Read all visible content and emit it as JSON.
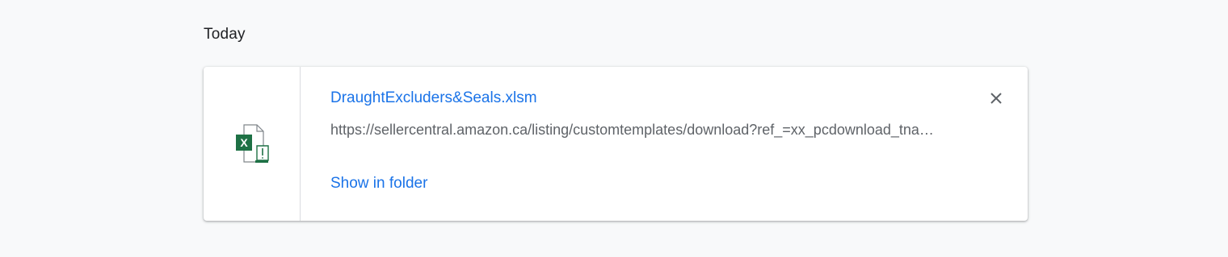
{
  "section": {
    "title": "Today"
  },
  "download": {
    "file_name": "DraughtExcluders&Seals.xlsm",
    "url": "https://sellercentral.amazon.ca/listing/customtemplates/download?ref_=xx_pcdownload_tnav_add",
    "show_in_folder_label": "Show in folder",
    "file_icon": "excel-file-warning-icon",
    "file_icon_letter": "X",
    "close_icon": "close-icon"
  },
  "colors": {
    "link": "#1a73e8",
    "excel_green": "#1e7145",
    "background": "#f8f9fa"
  }
}
